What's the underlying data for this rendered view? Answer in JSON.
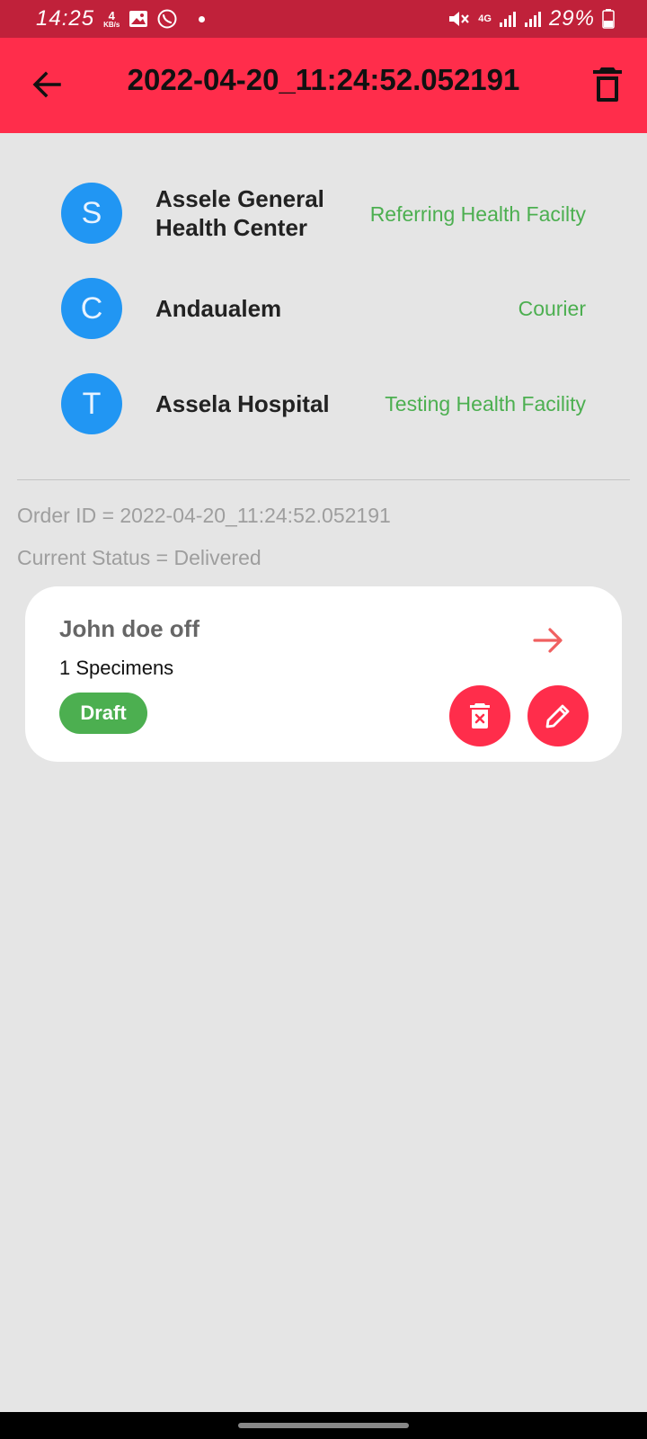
{
  "status_bar": {
    "time": "14:25",
    "speed_value": "4",
    "speed_unit": "KB/s",
    "network": "4G",
    "battery": "29%"
  },
  "app_bar": {
    "title": "2022-04-20_11:24:52.052191"
  },
  "parties": [
    {
      "initial": "S",
      "name": "Assele General Health Center",
      "role": "Referring Health Facilty"
    },
    {
      "initial": "C",
      "name": "Andaualem",
      "role": "Courier"
    },
    {
      "initial": "T",
      "name": "Assela Hospital",
      "role": "Testing Health Facility"
    }
  ],
  "order": {
    "id_line": "Order ID = 2022-04-20_11:24:52.052191",
    "status_line": "Current Status = Delivered"
  },
  "card": {
    "title": "John doe off",
    "specimens": "1 Specimens",
    "badge": "Draft"
  },
  "colors": {
    "status_bar": "#c0213a",
    "app_bar": "#ff2d4b",
    "avatar": "#2196f3",
    "role_text": "#4caf50",
    "badge": "#4caf50",
    "action_button": "#ff2d4b",
    "arrow": "#f06060"
  },
  "icons": {
    "back": "arrow-left-icon",
    "delete": "trash-icon",
    "forward": "arrow-right-icon",
    "delete_card": "trash-x-icon",
    "edit": "pencil-icon"
  }
}
